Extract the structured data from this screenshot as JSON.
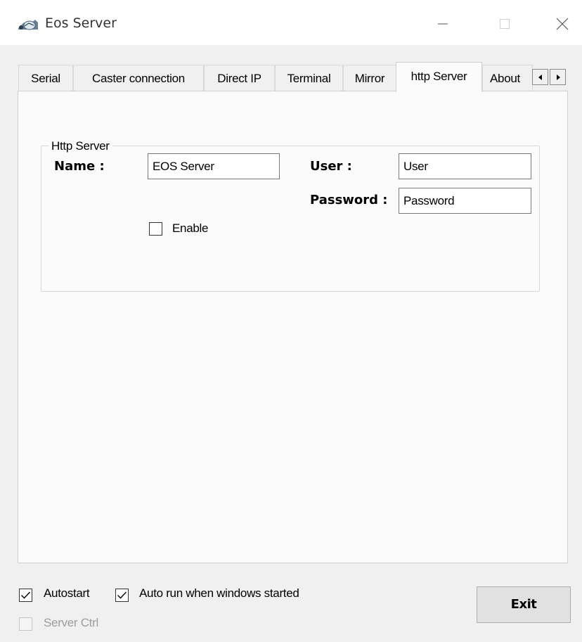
{
  "window": {
    "title": "Eos Server",
    "icon": "eos-app-icon",
    "controls": {
      "minimize": "minimize-icon",
      "maximize": "maximize-icon",
      "close": "close-icon"
    }
  },
  "tabs": [
    {
      "label": "Serial",
      "active": false
    },
    {
      "label": "Caster connection",
      "active": false
    },
    {
      "label": "Direct IP",
      "active": false
    },
    {
      "label": "Terminal",
      "active": false
    },
    {
      "label": "Mirror",
      "active": false
    },
    {
      "label": "http Server",
      "active": true
    },
    {
      "label": "About",
      "active": false
    }
  ],
  "tab_scroll": {
    "left": "scroll-left-icon",
    "right": "scroll-right-icon"
  },
  "http_server": {
    "group_title": "Http Server",
    "name_label": "Name :",
    "name_value": "EOS Server",
    "user_label": "User :",
    "user_value": "User",
    "password_label": "Password :",
    "password_value": "Password",
    "enable_label": "Enable",
    "enable_checked": false
  },
  "footer": {
    "autostart_label": "Autostart",
    "autostart_checked": true,
    "autorun_label": "Auto run when windows started",
    "autorun_checked": true,
    "server_ctrl_label": "Server Ctrl",
    "server_ctrl_checked": false,
    "server_ctrl_enabled": false,
    "exit_label": "Exit"
  },
  "colors": {
    "window_bg": "#f0f0f0",
    "titlebar_bg": "#ffffff",
    "panel_bg": "#fbfbfb",
    "disabled_text": "#9d9d9d"
  }
}
